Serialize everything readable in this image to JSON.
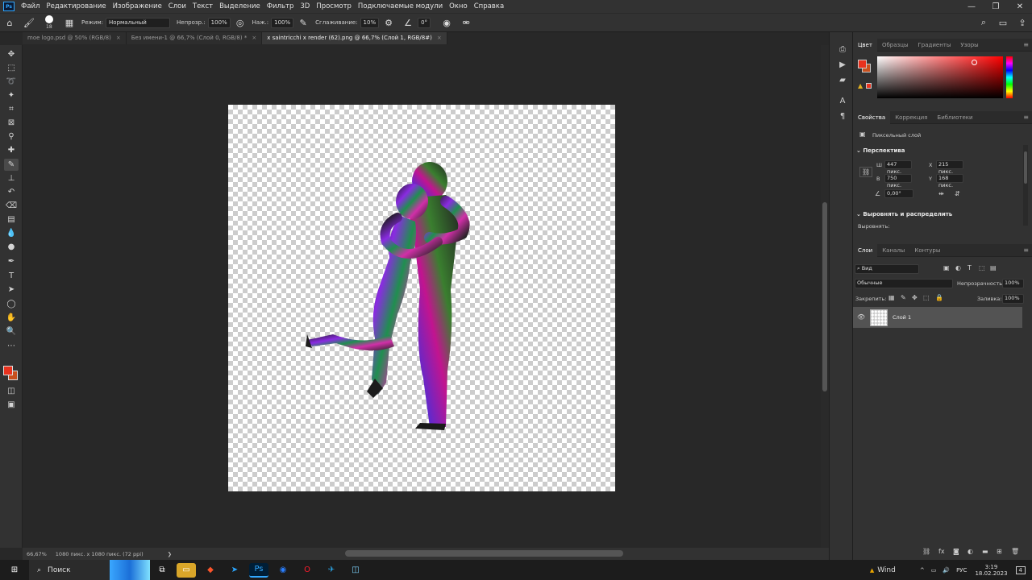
{
  "menubar": {
    "logo": "Ps",
    "items": [
      "Файл",
      "Редактирование",
      "Изображение",
      "Слои",
      "Текст",
      "Выделение",
      "Фильтр",
      "3D",
      "Просмотр",
      "Подключаемые модули",
      "Окно",
      "Справка"
    ],
    "window_buttons": [
      "—",
      "❐",
      "✕"
    ]
  },
  "options": {
    "brush_size": "18",
    "mode_label": "Режим:",
    "mode_value": "Нормальный",
    "opacity_label": "Непрозр.:",
    "opacity_value": "100%",
    "pressure_label": "Наж.:",
    "pressure_value": "100%",
    "smoothing_label": "Сглаживание:",
    "smoothing_value": "10%",
    "angle_value": "0°"
  },
  "tabs": [
    {
      "label": "moe logo.psd @ 50% (RGB/8)",
      "close": "×"
    },
    {
      "label": "Без имени-1 @ 66,7% (Слой 0, RGB/8) *",
      "close": "×"
    },
    {
      "label": "x saintricchi x render (62).png @ 66,7% (Слой 1, RGB/8#)",
      "close": "×"
    }
  ],
  "status": {
    "zoom": "66,67%",
    "doc_info": "1080 пикс. x 1080 пикс. (72 ppi)",
    "arrow": "❯"
  },
  "color_panel": {
    "tabs": [
      "Цвет",
      "Образцы",
      "Градиенты",
      "Узоры"
    ],
    "foreground": "#e8321e",
    "background": "#c8501e"
  },
  "properties_panel": {
    "tabs": [
      "Свойства",
      "Коррекция",
      "Библиотеки"
    ],
    "layer_type": "Пиксельный слой",
    "section_perspective": "Перспектива",
    "w_label": "Ш",
    "w_value": "447 пикс.",
    "h_label": "В",
    "h_value": "750 пикс.",
    "x_label": "X",
    "x_value": "215 пикс.",
    "y_label": "Y",
    "y_value": "168 пикс.",
    "angle_value": "0,00°",
    "section_align": "Выровнять и распределить",
    "align_label": "Выровнять:"
  },
  "layers_panel": {
    "tabs": [
      "Слои",
      "Каналы",
      "Контуры"
    ],
    "filter_value": "Вид",
    "blend_mode": "Обычные",
    "opacity_label": "Непрозрачность:",
    "opacity_value": "100%",
    "lock_label": "Закрепить:",
    "fill_label": "Заливка:",
    "fill_value": "100%",
    "layer_name": "Слой 1"
  },
  "taskbar": {
    "search_label": "Поиск",
    "weather": "Wind",
    "lang": "РУС",
    "time": "3:19",
    "date": "18.02.2023",
    "notifications": "4"
  }
}
